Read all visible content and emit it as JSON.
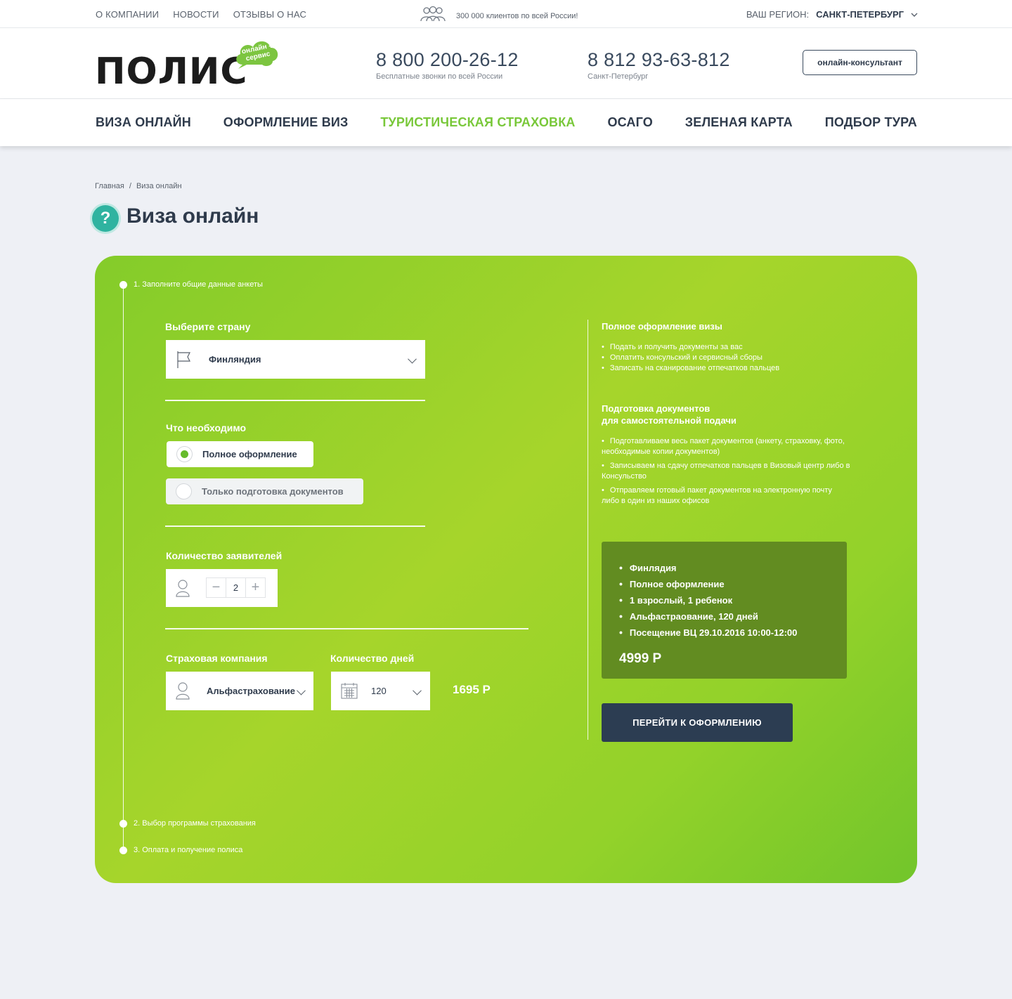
{
  "topbar": {
    "links": [
      "О КОМПАНИИ",
      "НОВОСТИ",
      "ОТЗЫВЫ О НАС"
    ],
    "clients_text": "300 000 клиентов по всей России!",
    "region_label": "ВАШ РЕГИОН:",
    "region_value": "САНКТ-ПЕТЕРБУРГ"
  },
  "header": {
    "logo_word": "ПОЛИС",
    "logo_cloud_text": "онлайн - сервис",
    "phone1": {
      "number": "8 800 200-26-12",
      "note": "Бесплатные звонки по всей России"
    },
    "phone2": {
      "number": "8 812 93-63-812",
      "note": "Санкт-Петербург"
    },
    "consult_button": "онлайн-консультант"
  },
  "nav": {
    "items": [
      "ВИЗА ОНЛАЙН",
      "ОФОРМЛЕНИЕ ВИЗ",
      "ТУРИСТИЧЕСКАЯ СТРАХОВКА",
      "ОСАГО",
      "ЗЕЛЕНАЯ КАРТА",
      "ПОДБОР ТУРА"
    ],
    "active_index": 2
  },
  "breadcrumb": {
    "home": "Главная",
    "separator": "/",
    "current": "Виза онлайн"
  },
  "page_title": "Виза онлайн",
  "steps": [
    "1. Заполните общие данные анкеты",
    "2. Выбор программы страхования",
    "3. Оплата и получение полиса"
  ],
  "form": {
    "country_label": "Выберите страну",
    "country_value": "Финляндия",
    "need_label": "Что необходимо",
    "option_full": "Полное оформление",
    "option_docs": "Только подготовка документов",
    "applicants_label": "Количество заявителей",
    "applicants_value": "2",
    "insurer_label": "Страховая компания",
    "insurer_value": "Альфастрахование",
    "days_label": "Количество дней",
    "days_value": "120",
    "insurance_price": "1695 Р"
  },
  "info": {
    "full_title": "Полное оформление визы",
    "full_items": [
      "Подать и получить документы за вас",
      "Оплатить консульский и сервисный сборы",
      "Записать на сканирование отпечатков пальцев"
    ],
    "docs_title_1": "Подготовка документов",
    "docs_title_2": "для самостоятельной подачи",
    "docs_items": [
      "Подготавливаем весь пакет документов (анкету, страховку, фото, необходимые копии документов)",
      "Записываем на сдачу отпечатков пальцев в Визовый центр либо в Консульство",
      "Отправляем готовый пакет документов на электронную почту либо в один из наших офисов"
    ]
  },
  "summary": {
    "items": [
      "Финлядия",
      "Полное оформление",
      "1 взрослый, 1 ребенок",
      "Альфастраование, 120 дней",
      "Посещение ВЦ 29.10.2016 10:00-12:00"
    ],
    "total": "4999 Р"
  },
  "submit_button": "ПЕРЕЙТИ К ОФОРМЛЕНИЮ",
  "colors": {
    "accent_green": "#79c83a",
    "panel_green": "#a6d52b",
    "summary_green": "#628c21",
    "button_dark": "#2c3d52",
    "text_dark": "#2f3b4c"
  }
}
